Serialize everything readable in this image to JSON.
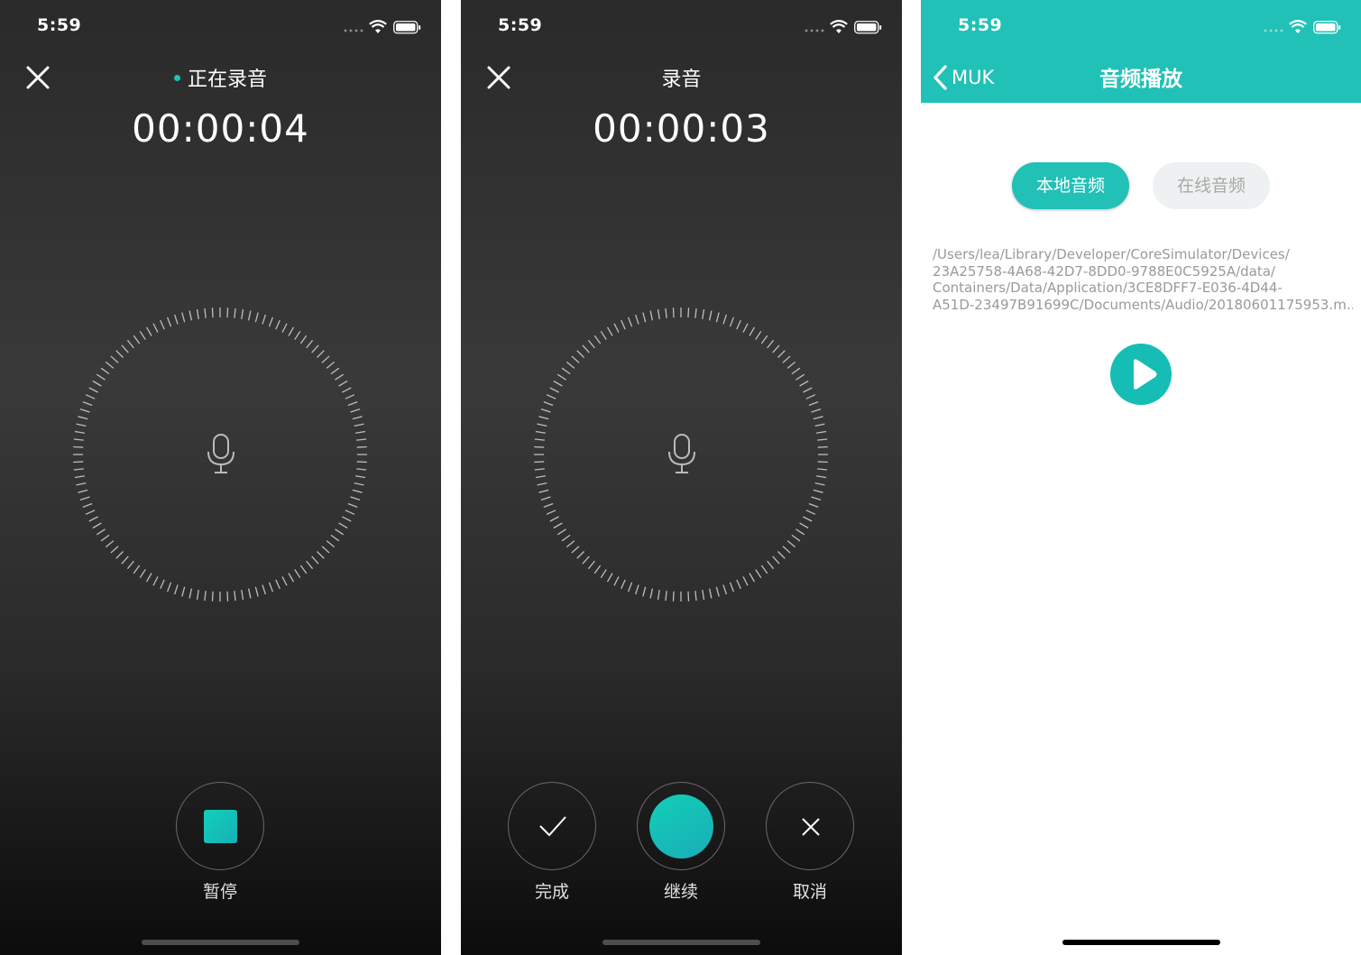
{
  "colors": {
    "accent": "#1ec1b7",
    "dark_bg": "#2d2d2d",
    "header_teal": "#21c1b7"
  },
  "screens": [
    {
      "status_time": "5:59",
      "title": "正在录音",
      "recording_indicator": true,
      "timer": "00:00:04",
      "mic_icon": "microphone-icon",
      "controls": [
        {
          "label": "暂停",
          "icon": "stop-square-icon"
        }
      ]
    },
    {
      "status_time": "5:59",
      "title": "录音",
      "timer": "00:00:03",
      "mic_icon": "microphone-icon",
      "controls": [
        {
          "label": "完成",
          "icon": "checkmark-icon"
        },
        {
          "label": "继续",
          "icon": "record-circle-icon"
        },
        {
          "label": "取消",
          "icon": "close-icon"
        }
      ]
    },
    {
      "status_time": "5:59",
      "back_label": "MUK",
      "nav_title": "音频播放",
      "tabs": [
        {
          "label": "本地音频",
          "selected": true
        },
        {
          "label": "在线音频",
          "selected": false
        }
      ],
      "file_path_lines": [
        "/Users/lea/Library/Developer/CoreSimulator/Devices/",
        "23A25758-4A68-42D7-8DD0-9788E0C5925A/data/",
        "Containers/Data/Application/3CE8DFF7-E036-4D44-",
        "A51D-23497B91699C/Documents/Audio/20180601175953.m..."
      ],
      "play_icon": "play-icon"
    }
  ]
}
